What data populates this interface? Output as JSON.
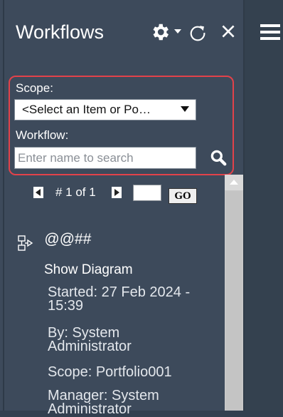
{
  "header": {
    "title": "Workflows"
  },
  "filters": {
    "scope_label": "Scope:",
    "scope_selected": "<Select an Item or Po…",
    "workflow_label": "Workflow:",
    "workflow_placeholder": "Enter name to search",
    "workflow_value": ""
  },
  "pager": {
    "status": "# 1 of 1",
    "page_value": "",
    "go_label": "GO"
  },
  "workflow": {
    "name": "@@##",
    "show_diagram_label": "Show Diagram",
    "started_line1": "Started: 27 Feb 2024 -",
    "started_line2": "15:39",
    "by_line1": "By: System",
    "by_line2": "Administrator",
    "scope": "Scope: Portfolio001",
    "manager_line1": "Manager: System",
    "manager_line2": "Administrator"
  },
  "colors": {
    "panel_bg": "#3d4a5b",
    "highlight_border": "#e2424a"
  },
  "icons": [
    "gear-icon",
    "chevron-down-icon",
    "refresh-icon",
    "close-icon",
    "hamburger-menu-icon",
    "search-icon",
    "workflow-icon",
    "arrow-left-icon",
    "arrow-right-icon",
    "arrow-up-icon"
  ]
}
